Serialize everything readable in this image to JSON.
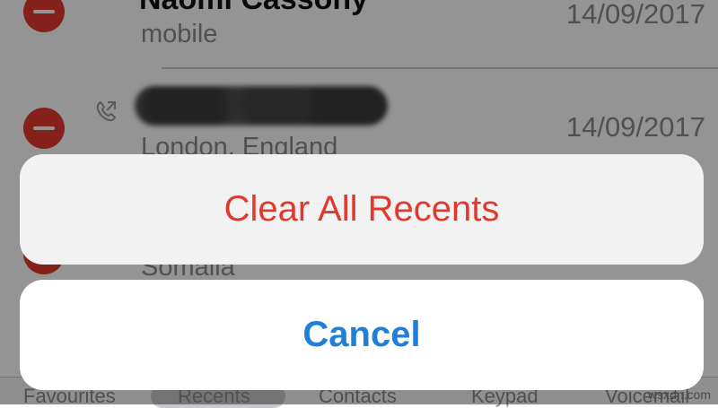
{
  "recents": [
    {
      "name": "Naomi Cassony",
      "subtitle": "mobile",
      "date": "14/09/2017"
    },
    {
      "name": "",
      "subtitle": "London, England",
      "date": "14/09/2017"
    },
    {
      "name": "",
      "subtitle": "Somalia",
      "date": ""
    }
  ],
  "tabbar": {
    "favourites": "Favourites",
    "recents": "Recents",
    "contacts": "Contacts",
    "keypad": "Keypad",
    "voicemail": "Voicemail"
  },
  "action_sheet": {
    "clear_label": "Clear All Recents",
    "cancel_label": "Cancel"
  },
  "watermark": "wsxdn.com",
  "colors": {
    "destructive": "#e1392d",
    "accent": "#1f7fd9",
    "delete_badge": "#e53a30"
  }
}
